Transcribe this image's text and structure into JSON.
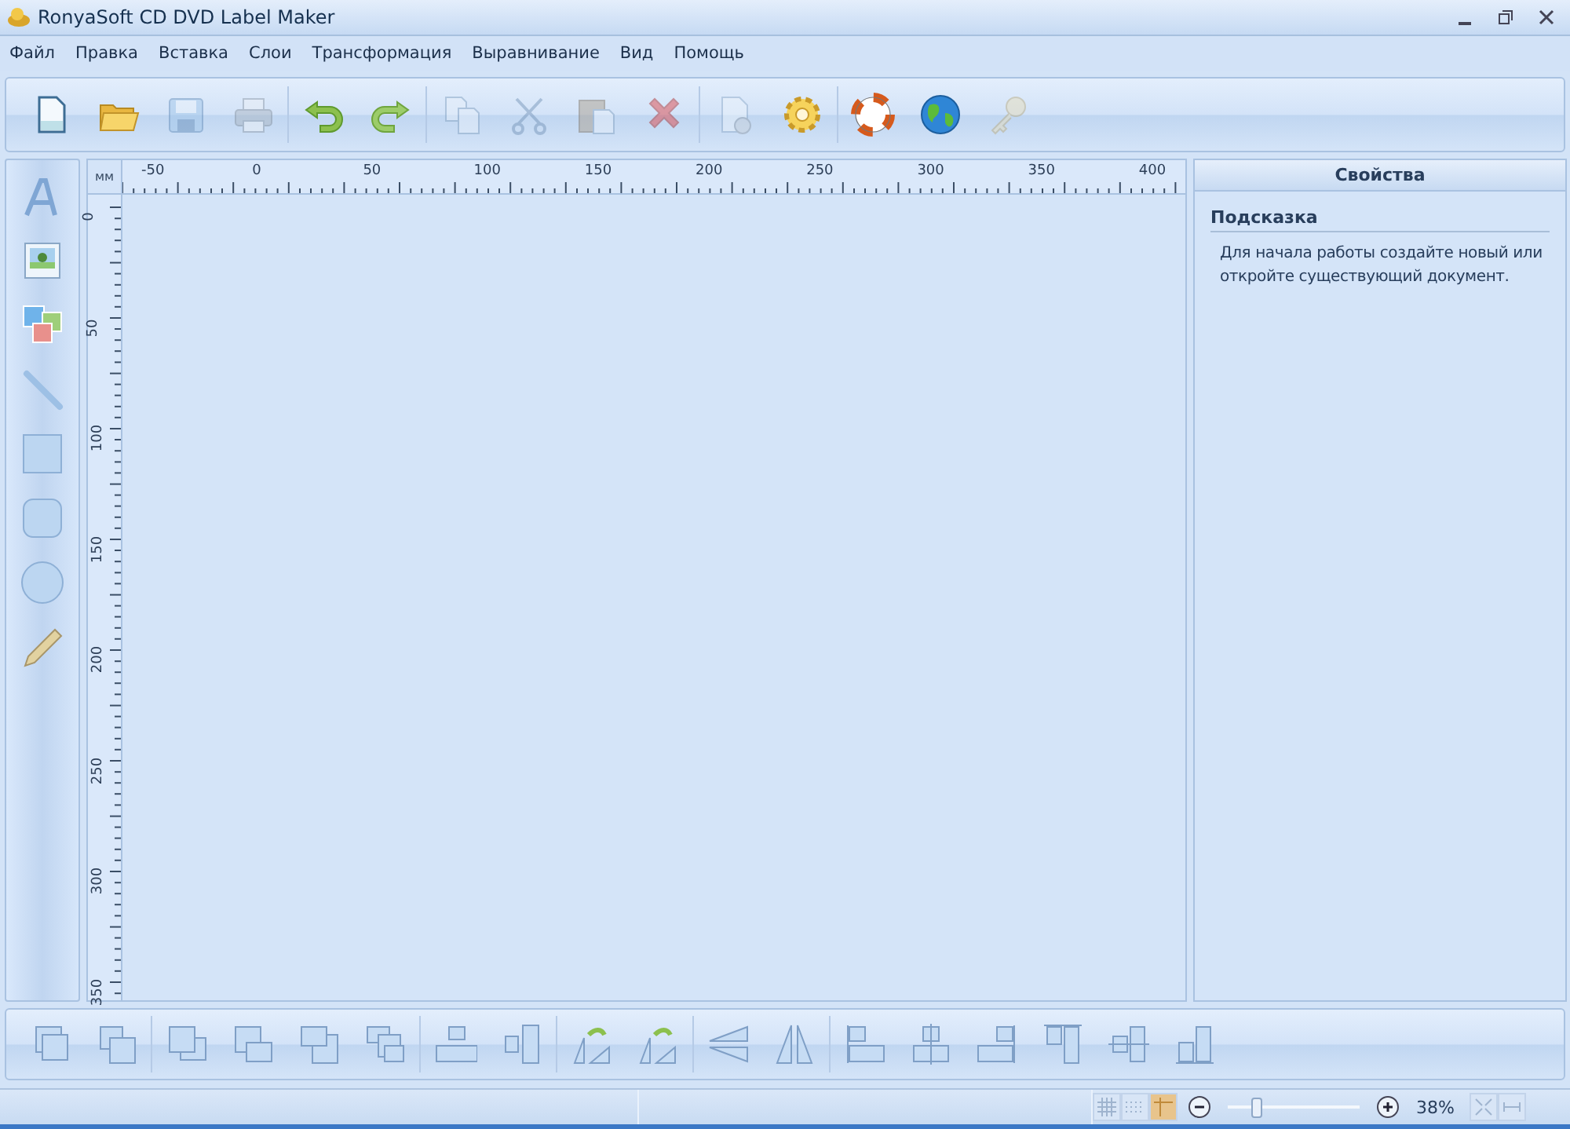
{
  "window": {
    "title": "RonyaSoft CD DVD Label Maker"
  },
  "menu": [
    "Файл",
    "Правка",
    "Вставка",
    "Слои",
    "Трансформация",
    "Выравнивание",
    "Вид",
    "Помощь"
  ],
  "toolbar": [
    [
      {
        "kind": "new",
        "disabled": false
      },
      {
        "kind": "open",
        "disabled": false
      },
      {
        "kind": "save",
        "disabled": true
      },
      {
        "kind": "print",
        "disabled": true
      }
    ],
    [
      {
        "kind": "undo",
        "disabled": false
      },
      {
        "kind": "redo",
        "disabled": false
      }
    ],
    [
      {
        "kind": "copy",
        "disabled": true
      },
      {
        "kind": "cut",
        "disabled": true
      },
      {
        "kind": "paste",
        "disabled": true
      },
      {
        "kind": "delete",
        "disabled": true
      }
    ],
    [
      {
        "kind": "pagesetup",
        "disabled": true
      },
      {
        "kind": "settings",
        "disabled": false
      }
    ],
    [
      {
        "kind": "help",
        "disabled": false
      },
      {
        "kind": "web",
        "disabled": false
      },
      {
        "kind": "key",
        "disabled": true
      }
    ]
  ],
  "tools": [
    {
      "kind": "text"
    },
    {
      "kind": "image"
    },
    {
      "kind": "images"
    },
    {
      "kind": "line"
    },
    {
      "kind": "rect"
    },
    {
      "kind": "roundrect"
    },
    {
      "kind": "ellipse"
    },
    {
      "kind": "pencil"
    }
  ],
  "ruler": {
    "unit": "мм",
    "x_labels": [
      "-50",
      "0",
      "50",
      "100",
      "150",
      "200",
      "250",
      "300",
      "350",
      "400"
    ],
    "y_labels": [
      "0",
      "50",
      "100",
      "150",
      "200",
      "250",
      "300",
      "350"
    ]
  },
  "properties": {
    "title": "Свойства",
    "section": "Подсказка",
    "hint": "Для начала работы создайте новый или откройте существующий документ."
  },
  "bottom_toolbar": [
    [
      {
        "kind": "select"
      },
      {
        "kind": "multiselect"
      }
    ],
    [
      {
        "kind": "front"
      },
      {
        "kind": "forward"
      },
      {
        "kind": "backward"
      },
      {
        "kind": "back"
      }
    ],
    [
      {
        "kind": "centerh"
      },
      {
        "kind": "centerv"
      }
    ],
    [
      {
        "kind": "rotl"
      },
      {
        "kind": "rotr"
      }
    ],
    [
      {
        "kind": "fliph"
      },
      {
        "kind": "flipv"
      }
    ],
    [
      {
        "kind": "alignleft"
      },
      {
        "kind": "aligncenter"
      },
      {
        "kind": "alignright"
      },
      {
        "kind": "aligntop"
      },
      {
        "kind": "alignmiddle"
      },
      {
        "kind": "alignbottom"
      }
    ]
  ],
  "status_bar": {
    "toggles": [
      {
        "kind": "grid",
        "on": false
      },
      {
        "kind": "dots",
        "on": false
      },
      {
        "kind": "guides",
        "on": true
      }
    ],
    "zoom": {
      "level": 0.2,
      "reading": "38%"
    }
  }
}
